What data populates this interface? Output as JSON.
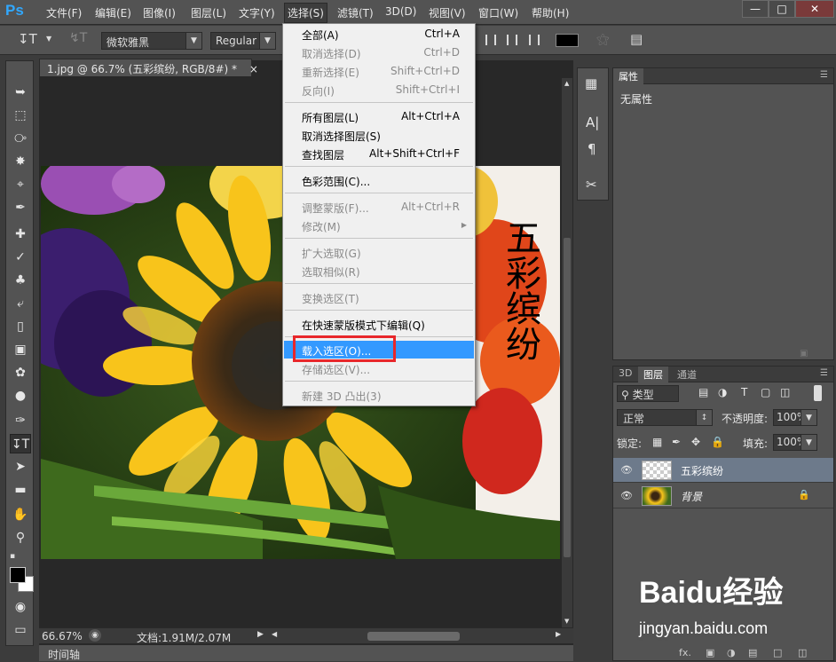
{
  "app": {
    "logo": "Ps",
    "menus": [
      "文件(F)",
      "编辑(E)",
      "图像(I)",
      "图层(L)",
      "文字(Y)",
      "选择(S)",
      "滤镜(T)",
      "3D(D)",
      "视图(V)",
      "窗口(W)",
      "帮助(H)"
    ],
    "active_menu": "选择(S)"
  },
  "options_bar": {
    "font_family": "微软雅黑",
    "font_style": "Regular"
  },
  "document": {
    "tab_title": "1.jpg @ 66.7% (五彩缤纷, RGB/8#) *",
    "canvas_text": "五彩缤纷",
    "zoom": "66.67%",
    "doc_info": "文档:1.91M/2.07M"
  },
  "timeline": {
    "label": "时间轴"
  },
  "properties": {
    "tab": "属性",
    "content": "无属性"
  },
  "layers_panel": {
    "tabs": [
      "3D",
      "图层",
      "通道"
    ],
    "active_tab": "图层",
    "filter_type": "类型",
    "blend_mode": "正常",
    "opacity_label": "不透明度:",
    "opacity_value": "100%",
    "lock_label": "锁定:",
    "fill_label": "填充:",
    "fill_value": "100%",
    "layers": [
      {
        "name": "五彩缤纷",
        "selected": true,
        "locked": false
      },
      {
        "name": "背景",
        "selected": false,
        "locked": true
      }
    ]
  },
  "select_menu": {
    "items": [
      {
        "label": "全部(A)",
        "shortcut": "Ctrl+A",
        "disabled": false
      },
      {
        "label": "取消选择(D)",
        "shortcut": "Ctrl+D",
        "disabled": true
      },
      {
        "label": "重新选择(E)",
        "shortcut": "Shift+Ctrl+D",
        "disabled": true
      },
      {
        "label": "反向(I)",
        "shortcut": "Shift+Ctrl+I",
        "disabled": true
      },
      {
        "label": "所有图层(L)",
        "shortcut": "Alt+Ctrl+A",
        "disabled": false
      },
      {
        "label": "取消选择图层(S)",
        "shortcut": "",
        "disabled": false
      },
      {
        "label": "查找图层",
        "shortcut": "Alt+Shift+Ctrl+F",
        "disabled": false
      },
      {
        "label": "色彩范围(C)...",
        "shortcut": "",
        "disabled": false
      },
      {
        "label": "调整蒙版(F)...",
        "shortcut": "Alt+Ctrl+R",
        "disabled": true
      },
      {
        "label": "修改(M)",
        "shortcut": "",
        "disabled": true
      },
      {
        "label": "扩大选取(G)",
        "shortcut": "",
        "disabled": true
      },
      {
        "label": "选取相似(R)",
        "shortcut": "",
        "disabled": true
      },
      {
        "label": "变换选区(T)",
        "shortcut": "",
        "disabled": true
      },
      {
        "label": "在快速蒙版模式下编辑(Q)",
        "shortcut": "",
        "disabled": false
      },
      {
        "label": "载入选区(O)...",
        "shortcut": "",
        "disabled": false,
        "highlighted": true
      },
      {
        "label": "存储选区(V)...",
        "shortcut": "",
        "disabled": true
      },
      {
        "label": "新建 3D 凸出(3)",
        "shortcut": "",
        "disabled": true
      }
    ]
  },
  "watermark": {
    "brand": "Baidu经验",
    "url": "jingyan.baidu.com"
  }
}
